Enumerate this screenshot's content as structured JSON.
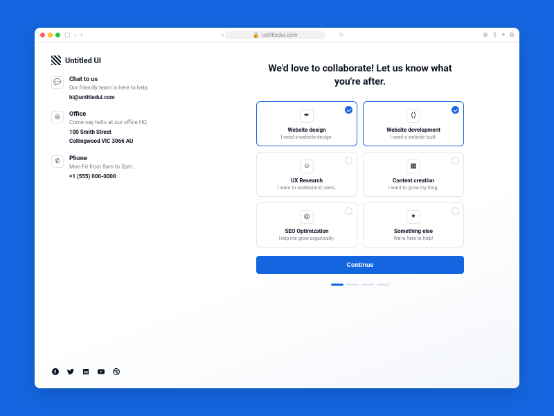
{
  "browser": {
    "url": "untitledui.com"
  },
  "brand": {
    "name": "Untitled UI"
  },
  "contact": {
    "chat": {
      "title": "Chat to us",
      "subtitle": "Our friendly team is here to help.",
      "value": "hi@untitledui.com"
    },
    "office": {
      "title": "Office",
      "subtitle": "Come say hello at our office HQ.",
      "line1": "100 Smith Street",
      "line2": "Collingwood VIC 3066 AU"
    },
    "phone": {
      "title": "Phone",
      "subtitle": "Mon-Fri from 8am to 5pm.",
      "value": "+1 (555) 000-0000"
    }
  },
  "headline": "We'd love to collaborate! Let us know what you're after.",
  "options": [
    {
      "title": "Website design",
      "subtitle": "I need a website design.",
      "selected": true
    },
    {
      "title": "Website development",
      "subtitle": "I need a website built.",
      "selected": true
    },
    {
      "title": "UX Research",
      "subtitle": "I want to understand users.",
      "selected": false
    },
    {
      "title": "Content creation",
      "subtitle": "I want to grow my blog.",
      "selected": false
    },
    {
      "title": "SEO Optimization",
      "subtitle": "Help me grow organically.",
      "selected": false
    },
    {
      "title": "Something else",
      "subtitle": "We're here to help!",
      "selected": false
    }
  ],
  "cta": {
    "continue": "Continue"
  },
  "progress": {
    "current": 1,
    "total": 4
  }
}
